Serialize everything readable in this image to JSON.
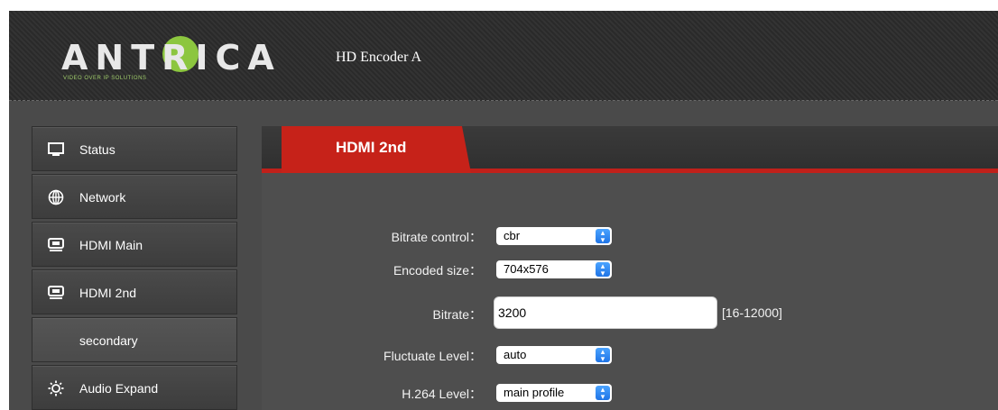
{
  "header": {
    "logo_text": "ANTRICA",
    "logo_tagline": "VIDEO OVER IP SOLUTIONS",
    "device_title": "HD Encoder  A"
  },
  "sidebar": {
    "items": [
      {
        "label": "Status",
        "icon": "monitor-icon"
      },
      {
        "label": "Network",
        "icon": "globe-icon"
      },
      {
        "label": "HDMI Main",
        "icon": "hdmi-icon"
      },
      {
        "label": "HDMI 2nd",
        "icon": "hdmi-icon"
      },
      {
        "label": "secondary",
        "icon": ""
      },
      {
        "label": "Audio Expand",
        "icon": "audio-settings-icon"
      }
    ]
  },
  "main": {
    "tab": {
      "label": "HDMI 2nd"
    },
    "form": {
      "bitrate_control": {
        "label": "Bitrate control：",
        "value": "cbr"
      },
      "encoded_size": {
        "label": "Encoded size：",
        "value": "704x576"
      },
      "bitrate": {
        "label": "Bitrate：",
        "value": "3200",
        "range": "[16-12000]"
      },
      "fluctuate_level": {
        "label": "Fluctuate Level：",
        "value": "auto"
      },
      "h264_level": {
        "label": "H.264 Level：",
        "value": "main profile"
      }
    }
  },
  "colors": {
    "accent": "#c62219",
    "logo_green": "#8cc63f",
    "select_caret": "#1f74e6"
  }
}
